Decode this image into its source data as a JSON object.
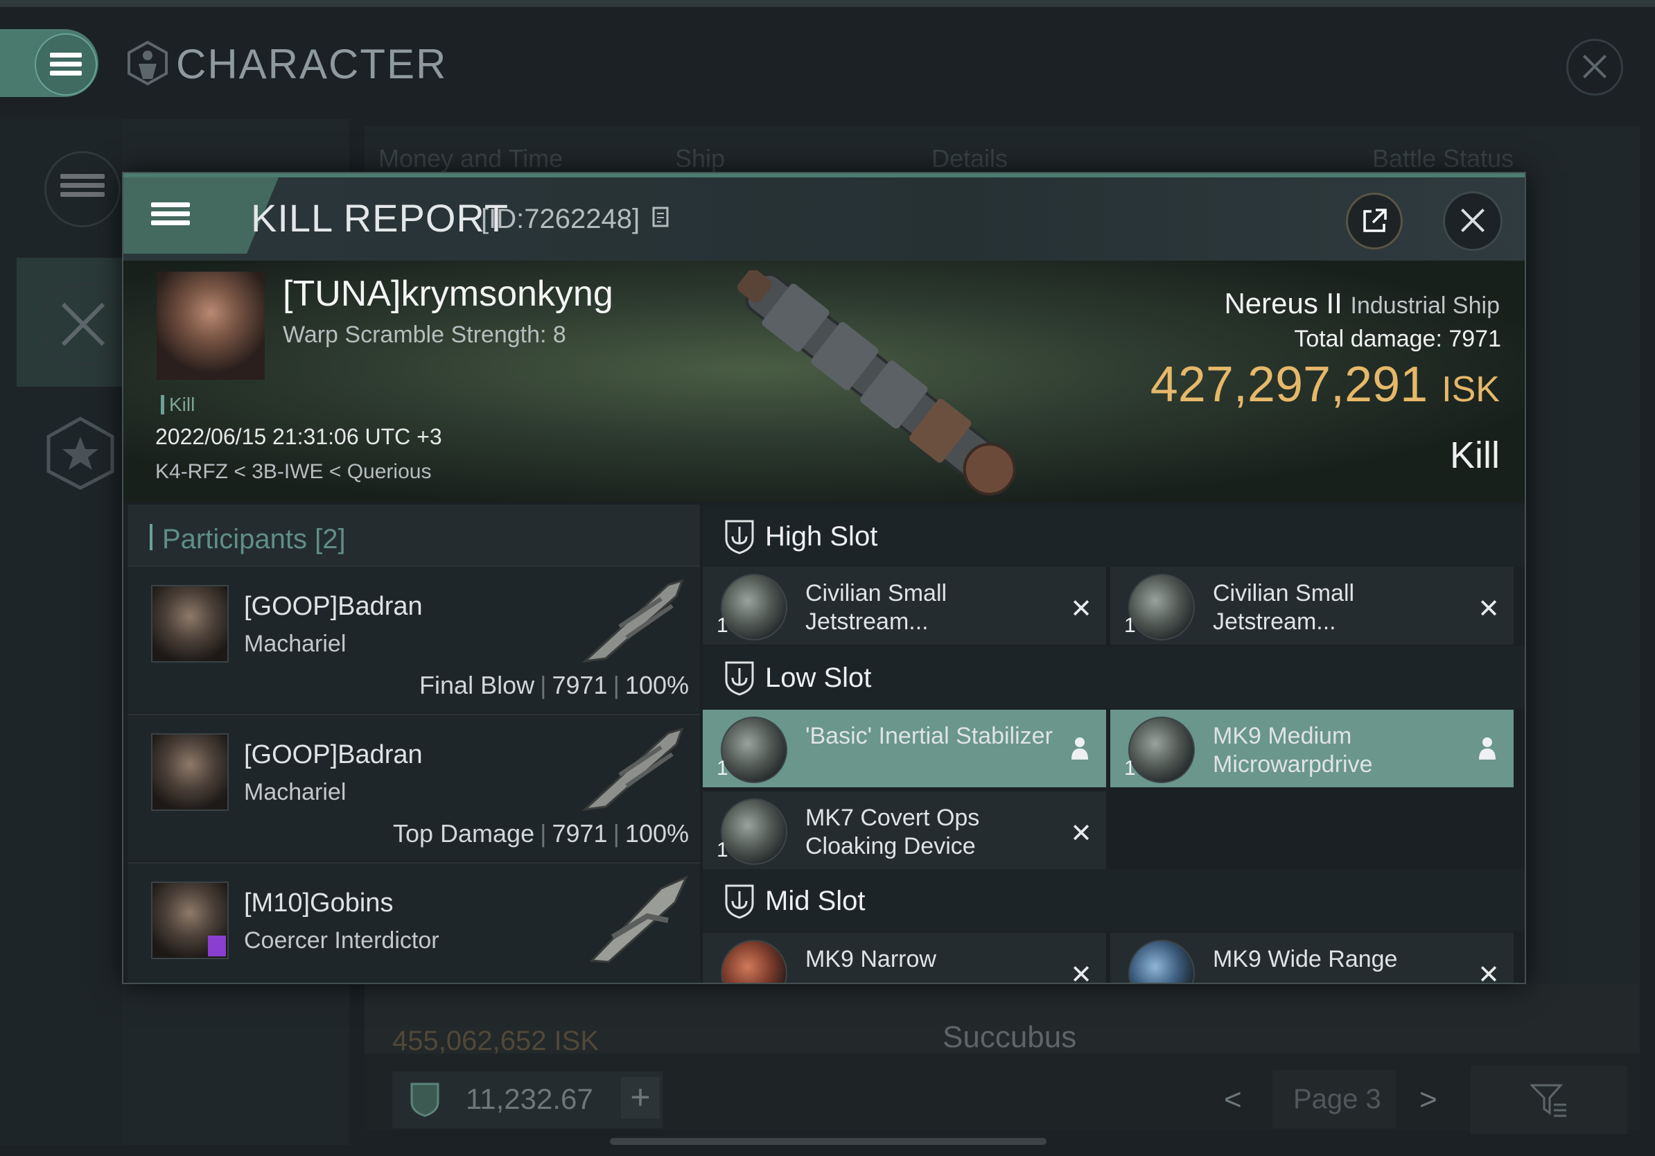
{
  "app": {
    "title": "CHARACTER"
  },
  "background_table": {
    "headers": [
      "Money and Time",
      "Ship",
      "Details",
      "Battle Status"
    ],
    "next_row": {
      "isk": "455,062,652 ISK",
      "ship": "Succubus"
    },
    "wallet": "11,232.67",
    "wallet_plus": "+",
    "page_label": "Page 3",
    "prev": "<",
    "next": ">"
  },
  "kill_report": {
    "title": "KILL REPORT",
    "id_label": "[ID:7262248]",
    "victim": {
      "name": "[TUNA]krymsonkyng",
      "warp_scramble": "Warp Scramble Strength: 8",
      "tag": "Kill",
      "datetime": "2022/06/15 21:31:06 UTC +3",
      "location": "K4-RFZ < 3B-IWE < Querious"
    },
    "ship": {
      "name": "Nereus II",
      "class": "Industrial Ship",
      "damage_label": "Total damage:",
      "damage_value": "7971",
      "isk_value": "427,297,291",
      "isk_unit": "ISK",
      "result": "Kill"
    },
    "participants": {
      "title": "Participants",
      "count": "[2]",
      "rows": [
        {
          "name": "[GOOP]Badran",
          "ship": "Machariel",
          "role": "Final Blow",
          "damage": "7971",
          "percent": "100%"
        },
        {
          "name": "[GOOP]Badran",
          "ship": "Machariel",
          "role": "Top Damage",
          "damage": "7971",
          "percent": "100%"
        },
        {
          "name": "[M10]Gobins",
          "ship": "Coercer Interdictor",
          "role": "",
          "damage": "",
          "percent": ""
        }
      ]
    },
    "slots": {
      "high": {
        "label": "High Slot",
        "items": [
          {
            "qty": "1",
            "name": "Civilian Small Jetstream...",
            "state": "destroyed"
          },
          {
            "qty": "1",
            "name": "Civilian Small Jetstream...",
            "state": "destroyed"
          }
        ]
      },
      "low": {
        "label": "Low Slot",
        "items": [
          {
            "qty": "1",
            "name": "'Basic' Inertial Stabilizer",
            "state": "dropped"
          },
          {
            "qty": "1",
            "name": "MK9 Medium Microwarpdrive",
            "state": "dropped"
          },
          {
            "qty": "1",
            "name": "MK7 Covert Ops Cloaking Device",
            "state": "destroyed"
          }
        ]
      },
      "mid": {
        "label": "Mid Slot",
        "items": [
          {
            "qty": "1",
            "name": "MK9 Narrow",
            "state": "destroyed"
          },
          {
            "qty": "1",
            "name": "MK9 Wide Range",
            "state": "destroyed"
          }
        ]
      }
    },
    "destroyed_mark": "✕"
  },
  "colors": {
    "accent": "#4a7a6e",
    "isk_gold": "#e6b86a",
    "fitted_item_bg": "#6a968c"
  },
  "icons": [
    "menu-icon",
    "character-icon",
    "close-icon",
    "share-icon",
    "shield-icon",
    "person-icon",
    "filter-icon",
    "copy-icon",
    "star-icon",
    "crossed-swords-icon"
  ]
}
